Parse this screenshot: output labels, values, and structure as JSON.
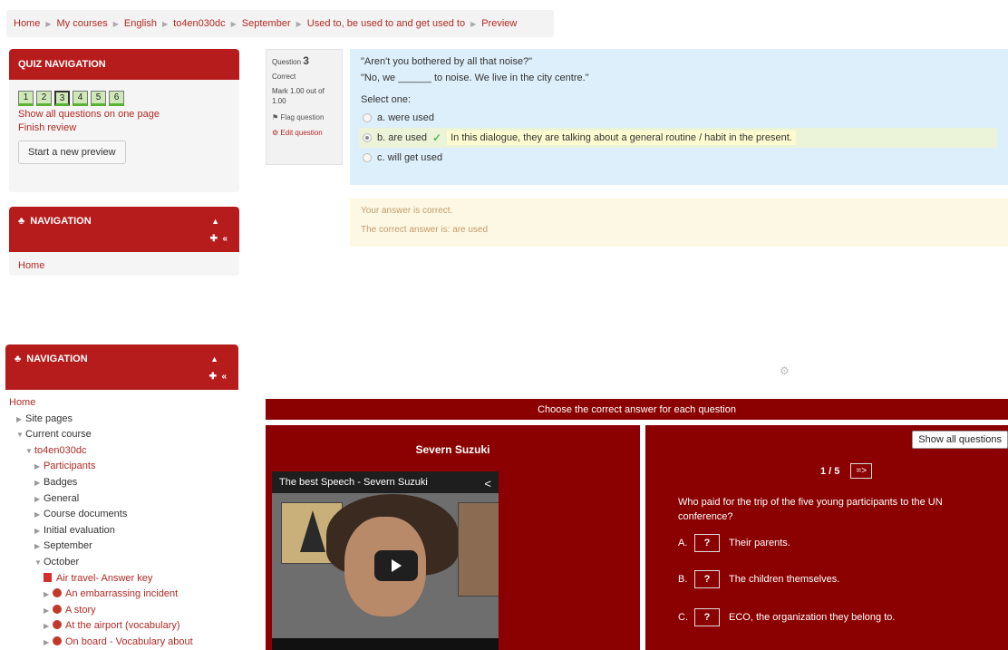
{
  "breadcrumb": [
    "Home",
    "My courses",
    "English",
    "to4en030dc",
    "September",
    "Used to, be used to and get used to",
    "Preview"
  ],
  "quiz_nav": {
    "title": "QUIZ NAVIGATION",
    "questions": [
      "1",
      "2",
      "3",
      "4",
      "5",
      "6"
    ],
    "show_all": "Show all questions on one page",
    "finish": "Finish review",
    "new_preview": "Start a new preview"
  },
  "nav_block": {
    "title": "NAVIGATION",
    "home": "Home"
  },
  "question_info": {
    "label": "Question",
    "number": "3",
    "state": "Correct",
    "mark": "Mark 1.00 out of 1.00",
    "flag": "Flag question",
    "edit": "Edit question"
  },
  "question": {
    "line1": "\"Aren't you bothered by all that noise?\"",
    "line2": "\"No, we ______ to noise. We live in the city centre.\"",
    "select": "Select one:",
    "options": [
      {
        "text": "a. were used"
      },
      {
        "text": "b. are used",
        "feedback": "In this dialogue, they are talking about a general routine / habit in the present."
      },
      {
        "text": "c. will get used"
      }
    ]
  },
  "outcome": {
    "line1": "Your answer is correct.",
    "line2": "The correct answer is: are used"
  },
  "nav_tree": {
    "title": "NAVIGATION",
    "items": [
      {
        "label": "Home"
      },
      {
        "label": "Site pages"
      },
      {
        "label": "Current course"
      },
      {
        "label": "to4en030dc"
      },
      {
        "label": "Participants"
      },
      {
        "label": "Badges"
      },
      {
        "label": "General"
      },
      {
        "label": "Course documents"
      },
      {
        "label": "Initial evaluation"
      },
      {
        "label": "September"
      },
      {
        "label": "October"
      },
      {
        "label": "Air travel- Answer key"
      },
      {
        "label": "An embarrassing incident"
      },
      {
        "label": "A story"
      },
      {
        "label": "At the airport (vocabulary)"
      },
      {
        "label": "On board - Vocabulary about"
      }
    ]
  },
  "activity": {
    "banner": "Choose the correct answer for each question",
    "video_title": "Severn Suzuki",
    "video_bar": "The best Speech - Severn Suzuki",
    "show_all": "Show all questions",
    "pager": "1 / 5",
    "next": "=>",
    "question": "Who paid for the trip of the five young participants to the UN conference?",
    "answers": [
      {
        "letter": "A.",
        "mark": "?",
        "text": "Their parents."
      },
      {
        "letter": "B.",
        "mark": "?",
        "text": "The children themselves."
      },
      {
        "letter": "C.",
        "mark": "?",
        "text": "ECO, the organization they belong to."
      }
    ]
  },
  "colors": {
    "brand_red": "#b71c1c",
    "activity_red": "#8b0000"
  }
}
